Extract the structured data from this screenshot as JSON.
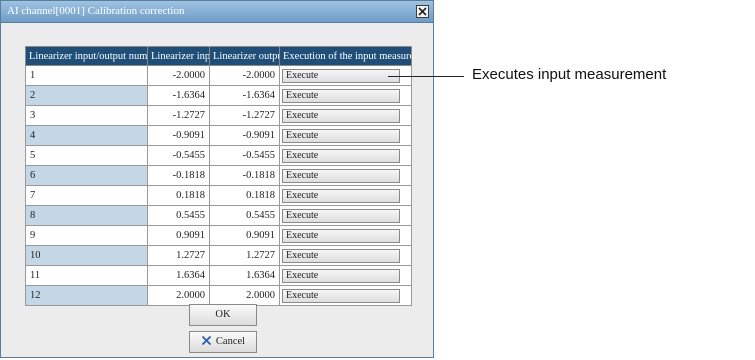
{
  "dialog": {
    "title": "AI channel[0001] Calibration correction",
    "close_icon": "close-icon"
  },
  "table": {
    "headers": [
      "Linearizer input/output number",
      "Linearizer input",
      "Linearizer output",
      "Execution of the input measurement"
    ],
    "rows": [
      {
        "number": "1",
        "input": "-2.0000",
        "output": "-2.0000",
        "action": "Execute"
      },
      {
        "number": "2",
        "input": "-1.6364",
        "output": "-1.6364",
        "action": "Execute"
      },
      {
        "number": "3",
        "input": "-1.2727",
        "output": "-1.2727",
        "action": "Execute"
      },
      {
        "number": "4",
        "input": "-0.9091",
        "output": "-0.9091",
        "action": "Execute"
      },
      {
        "number": "5",
        "input": "-0.5455",
        "output": "-0.5455",
        "action": "Execute"
      },
      {
        "number": "6",
        "input": "-0.1818",
        "output": "-0.1818",
        "action": "Execute"
      },
      {
        "number": "7",
        "input": "0.1818",
        "output": "0.1818",
        "action": "Execute"
      },
      {
        "number": "8",
        "input": "0.5455",
        "output": "0.5455",
        "action": "Execute"
      },
      {
        "number": "9",
        "input": "0.9091",
        "output": "0.9091",
        "action": "Execute"
      },
      {
        "number": "10",
        "input": "1.2727",
        "output": "1.2727",
        "action": "Execute"
      },
      {
        "number": "11",
        "input": "1.6364",
        "output": "1.6364",
        "action": "Execute"
      },
      {
        "number": "12",
        "input": "2.0000",
        "output": "2.0000",
        "action": "Execute"
      }
    ]
  },
  "buttons": {
    "ok_label": "OK",
    "cancel_label": "Cancel",
    "cancel_icon": "x-icon"
  },
  "callout": {
    "text": "Executes input measurement"
  },
  "colors": {
    "header_bg": "#1f4f79",
    "alt_row_bg": "#c3d7e6",
    "titlebar": "#6e9cc6",
    "cancel_x": "#2b5fa8"
  }
}
